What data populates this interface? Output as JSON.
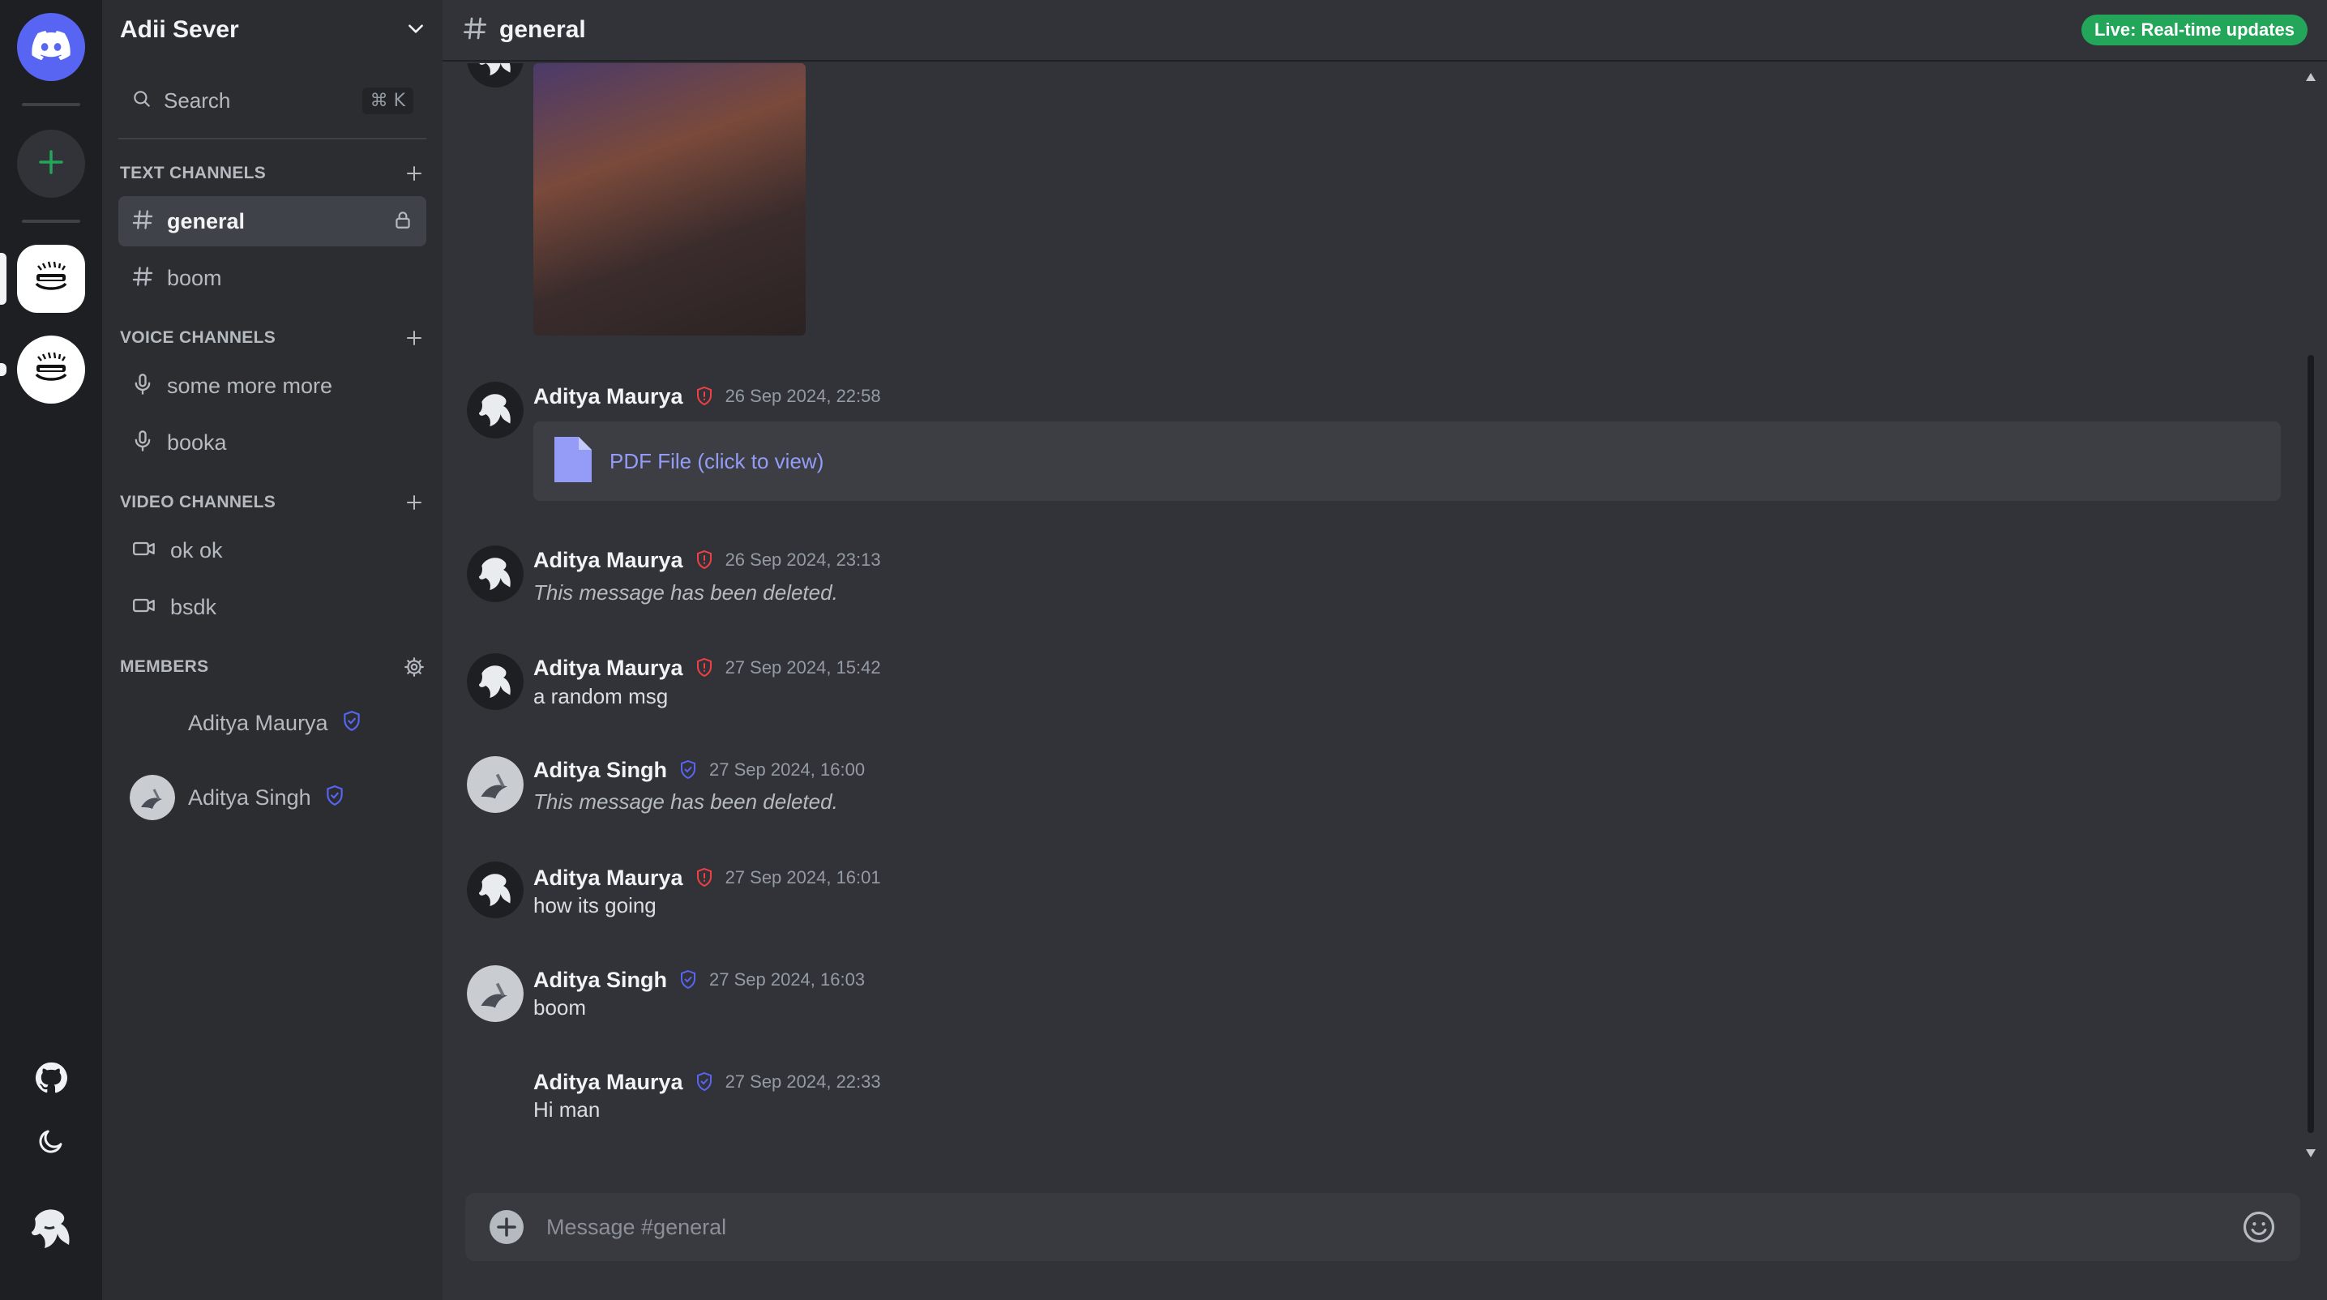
{
  "server": {
    "name": "Adii Sever"
  },
  "search": {
    "label": "Search",
    "shortcut": "⌘ K"
  },
  "sections": {
    "text": "TEXT CHANNELS",
    "voice": "VOICE CHANNELS",
    "video": "VIDEO CHANNELS",
    "members": "MEMBERS"
  },
  "text_channels": [
    "general",
    "boom"
  ],
  "voice_channels": [
    "some more more",
    "booka"
  ],
  "video_channels": [
    "ok ok",
    "bsdk"
  ],
  "members": [
    "Aditya Maurya",
    "Aditya Singh"
  ],
  "header": {
    "channel": "general",
    "live": "Live: Real-time updates"
  },
  "messages": [
    {
      "author": "Aditya Maurya",
      "time": "26 Sep 2024, 22:58",
      "attachment": "PDF File (click to view)"
    },
    {
      "author": "Aditya Maurya",
      "time": "26 Sep 2024, 23:13",
      "text": "This message has been deleted."
    },
    {
      "author": "Aditya Maurya",
      "time": "27 Sep 2024, 15:42",
      "text": "a random msg"
    },
    {
      "author": "Aditya Singh",
      "time": "27 Sep 2024, 16:00",
      "text": "This message has been deleted."
    },
    {
      "author": "Aditya Maurya",
      "time": "27 Sep 2024, 16:01",
      "text": "how its going"
    },
    {
      "author": "Aditya Singh",
      "time": "27 Sep 2024, 16:03",
      "text": "boom"
    },
    {
      "author": "Aditya Maurya",
      "time": "27 Sep 2024, 22:33",
      "text": "Hi man"
    }
  ],
  "composer": {
    "placeholder": "Message #general"
  },
  "colors": {
    "accent": "#5865f2",
    "add_server": "#23a55a",
    "live": "#23a55a",
    "admin_role": "#f23f43",
    "member_role": "#5865f2",
    "link": "#949cf7"
  }
}
